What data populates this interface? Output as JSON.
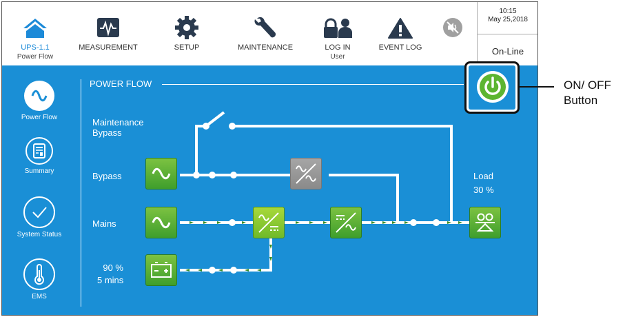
{
  "topbar": {
    "ups": {
      "label": "UPS-1.1",
      "sub": "Power Flow"
    },
    "measurement": {
      "label": "MEASUREMENT"
    },
    "setup": {
      "label": "SETUP"
    },
    "maintenance": {
      "label": "MAINTENANCE"
    },
    "login": {
      "label": "LOG IN",
      "sub": "User"
    },
    "eventlog": {
      "label": "EVENT LOG"
    },
    "time": "10:15",
    "date": "May 25,2018",
    "status": "On-Line"
  },
  "sidebar": {
    "items": [
      {
        "label": "Power Flow",
        "icon": "sine-wave-icon"
      },
      {
        "label": "Summary",
        "icon": "summary-icon"
      },
      {
        "label": "System Status",
        "icon": "checkmark-icon"
      },
      {
        "label": "EMS",
        "icon": "thermometer-icon"
      }
    ]
  },
  "powerflow": {
    "title": "POWER FLOW",
    "maintenance_bypass_line1": "Maintenance",
    "maintenance_bypass_line2": "Bypass",
    "bypass": "Bypass",
    "mains": "Mains",
    "battery_percent": "90 %",
    "battery_time": "5 mins",
    "load_label": "Load",
    "load_percent": "30 %"
  },
  "annotation": {
    "line1": "ON/ OFF",
    "line2": "Button"
  },
  "colors": {
    "accent_blue": "#1a8fd6",
    "ups_blue": "#1c8ad8",
    "module_green": "#4caf38",
    "power_button_green": "#5cb531"
  }
}
